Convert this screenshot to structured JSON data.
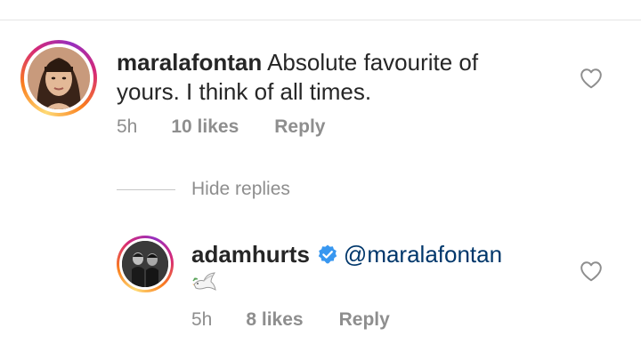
{
  "comment": {
    "username": "maralafontan",
    "text_line1": "Absolute favourite of",
    "text_line2": "yours. I think of all times.",
    "time": "5h",
    "likes": "10 likes",
    "reply_label": "Reply",
    "liked": false
  },
  "replies_toggle": {
    "label": "Hide replies"
  },
  "reply": {
    "username": "adamhurts",
    "verified": true,
    "mention": "@maralafontan",
    "emoji": "dove-emoji",
    "time": "5h",
    "likes": "8 likes",
    "reply_label": "Reply",
    "liked": false
  },
  "icons": {
    "like": "heart-outline-icon",
    "verified": "verified-badge-icon"
  },
  "colors": {
    "text": "#262626",
    "meta": "#8e8e8e",
    "mention": "#00376b",
    "verified": "#3897f0",
    "story_ring": [
      "#feda75",
      "#fa7e1e",
      "#d62976",
      "#962fbf"
    ]
  }
}
